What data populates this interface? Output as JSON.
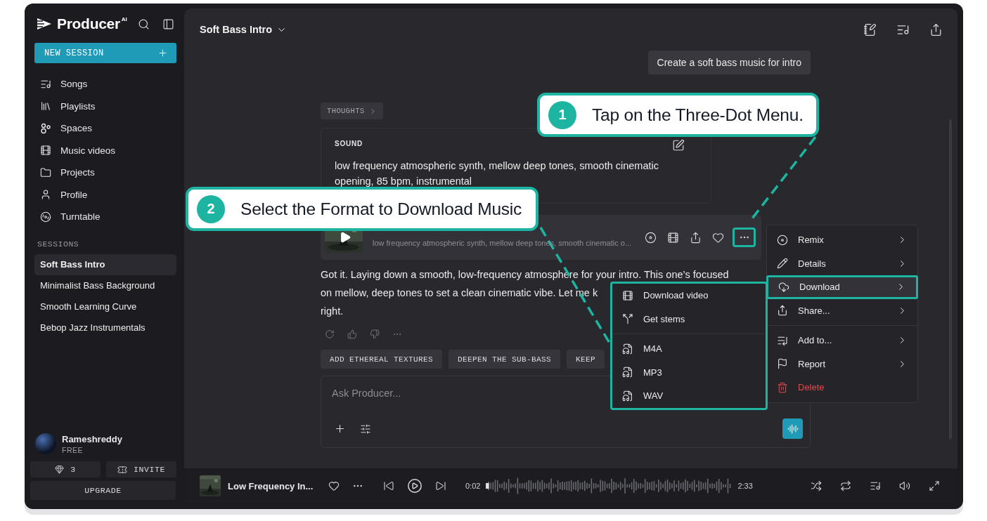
{
  "app": {
    "logo_text": "Producer",
    "logo_mark": "AI"
  },
  "new_session": "NEW SESSION",
  "nav": [
    {
      "label": "Songs",
      "kind": "songs"
    },
    {
      "label": "Playlists",
      "kind": "playlists"
    },
    {
      "label": "Spaces",
      "kind": "spaces"
    },
    {
      "label": "Music videos",
      "kind": "videos"
    },
    {
      "label": "Projects",
      "kind": "projects"
    },
    {
      "label": "Profile",
      "kind": "profile"
    },
    {
      "label": "Turntable",
      "kind": "turntable"
    }
  ],
  "sessions_heading": "SESSIONS",
  "sessions": [
    {
      "label": "Soft Bass Intro",
      "selected": true
    },
    {
      "label": "Minimalist Bass Background",
      "selected": false
    },
    {
      "label": "Smooth Learning Curve",
      "selected": false
    },
    {
      "label": "Bebop Jazz Instrumentals",
      "selected": false
    }
  ],
  "user": {
    "name": "Rameshreddy",
    "plan": "FREE"
  },
  "credits": "3",
  "invite": "INVITE",
  "upgrade": "UPGRADE",
  "header": {
    "title": "Soft Bass Intro"
  },
  "user_message": "Create a soft bass music for intro",
  "thoughts": "THOUGHTS",
  "sound": {
    "label": "SOUND",
    "text": "low frequency atmospheric synth, mellow deep tones, smooth cinematic opening, 85 bpm, instrumental"
  },
  "track": {
    "subtitle": "low frequency atmospheric synth, mellow deep tones, smooth cinematic o..."
  },
  "reply_lines": [
    "Got it. Laying down a smooth, low-frequency atmosphere for your intro. This one’s focused",
    "on mellow, deep tones to set a clean cinematic vibe. Let me k",
    "right."
  ],
  "suggestions": [
    "ADD ETHEREAL TEXTURES",
    "DEEPEN THE SUB-BASS",
    "KEEP"
  ],
  "composer": {
    "placeholder": "Ask Producer..."
  },
  "menu_groups": [
    [
      {
        "label": "Remix",
        "kind": "remix",
        "selected": false,
        "danger": false
      },
      {
        "label": "Details",
        "kind": "details",
        "selected": false,
        "danger": false
      },
      {
        "label": "Download",
        "kind": "download",
        "selected": true,
        "danger": false
      },
      {
        "label": "Share...",
        "kind": "share",
        "selected": false,
        "danger": false
      }
    ],
    [
      {
        "label": "Add to...",
        "kind": "add",
        "selected": false,
        "danger": false
      },
      {
        "label": "Report",
        "kind": "report",
        "selected": false,
        "danger": false
      },
      {
        "label": "Delete",
        "kind": "delete",
        "selected": false,
        "danger": true
      }
    ]
  ],
  "submenu_groups": [
    [
      {
        "label": "Download video",
        "kind": "video"
      },
      {
        "label": "Get stems",
        "kind": "stems"
      }
    ],
    [
      {
        "label": "M4A",
        "kind": "audio"
      },
      {
        "label": "MP3",
        "kind": "audio"
      },
      {
        "label": "WAV",
        "kind": "audio"
      }
    ]
  ],
  "player": {
    "title": "Low Frequency In...",
    "elapsed": "0:02",
    "duration": "2:33",
    "level": 0.013
  },
  "callouts": [
    {
      "number": "1",
      "text": "Tap on the Three-Dot Menu."
    },
    {
      "number": "2",
      "text": "Select the Format to Download Music"
    }
  ]
}
